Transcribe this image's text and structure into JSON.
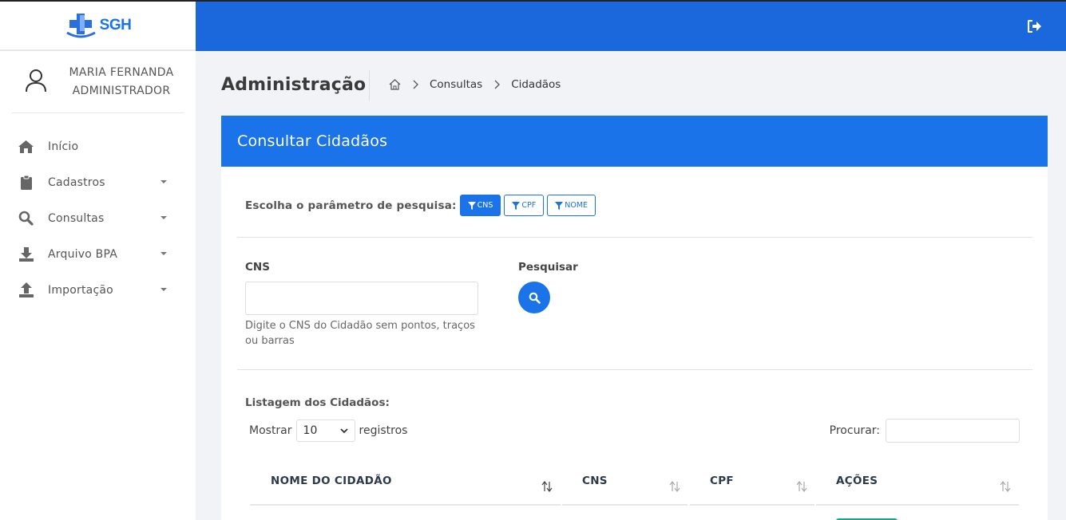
{
  "app": {
    "logo_text": "SGH"
  },
  "user": {
    "name": "MARIA FERNANDA",
    "role": "ADMINISTRADOR"
  },
  "sidebar": {
    "items": [
      {
        "label": "Início",
        "icon": "home-icon",
        "has_submenu": false
      },
      {
        "label": "Cadastros",
        "icon": "clipboard-icon",
        "has_submenu": true
      },
      {
        "label": "Consultas",
        "icon": "search-icon",
        "has_submenu": true
      },
      {
        "label": "Arquivo BPA",
        "icon": "download-icon",
        "has_submenu": true
      },
      {
        "label": "Importação",
        "icon": "upload-icon",
        "has_submenu": true
      }
    ]
  },
  "header": {
    "page_title": "Administração",
    "breadcrumb": [
      "Consultas",
      "Cidadãos"
    ]
  },
  "card": {
    "title": "Consultar Cidadãos",
    "param_label": "Escolha o parâmetro de pesquisa:",
    "filters": [
      {
        "label": "CNS",
        "active": true
      },
      {
        "label": "CPF",
        "active": false
      },
      {
        "label": "NOME",
        "active": false
      }
    ],
    "cns_label": "CNS",
    "cns_value": "",
    "cns_help": "Digite o CNS do Cidadão sem pontos, traços ou barras",
    "search_label": "Pesquisar"
  },
  "listing": {
    "title": "Listagem dos Cidadãos:",
    "show_label": "Mostrar",
    "show_value": "10",
    "records_label": "registros",
    "search_label": "Procurar:",
    "search_value": "",
    "columns": [
      "NOME DO CIDADÃO",
      "CNS",
      "CPF",
      "AÇÕES"
    ]
  },
  "colors": {
    "primary": "#1a73e8",
    "topbar": "#1a68dc",
    "action": "#1aa68a"
  }
}
